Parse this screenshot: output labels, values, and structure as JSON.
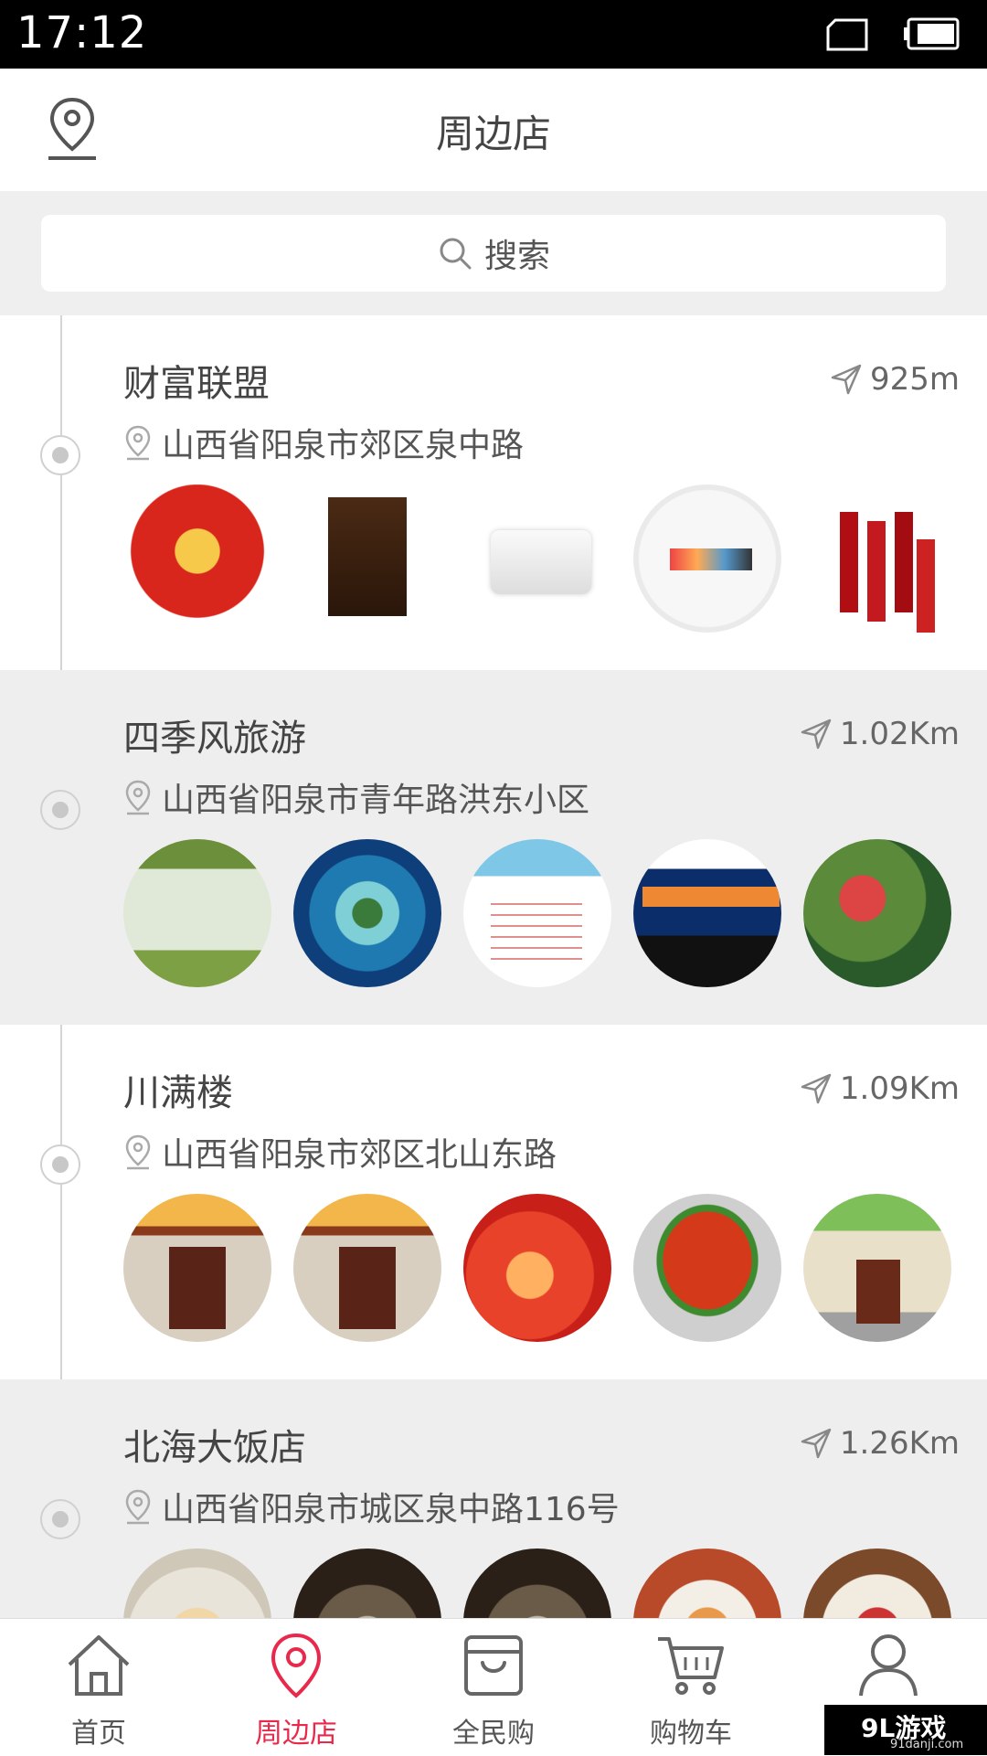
{
  "status_bar": {
    "time": "17:12"
  },
  "header": {
    "title": "周边店"
  },
  "search": {
    "placeholder": "搜索"
  },
  "stores": [
    {
      "name": "财富联盟",
      "distance": "925m",
      "address": "山西省阳泉市郊区泉中路"
    },
    {
      "name": "四季风旅游",
      "distance": "1.02Km",
      "address": "山西省阳泉市青年路洪东小区"
    },
    {
      "name": "川满楼",
      "distance": "1.09Km",
      "address": "山西省阳泉市郊区北山东路"
    },
    {
      "name": "北海大饭店",
      "distance": "1.26Km",
      "address": "山西省阳泉市城区泉中路116号"
    }
  ],
  "tabbar": {
    "items": [
      {
        "label": "首页",
        "icon": "home-icon"
      },
      {
        "label": "周边店",
        "icon": "location-pin-icon",
        "active": true
      },
      {
        "label": "全民购",
        "icon": "bag-icon"
      },
      {
        "label": "购物车",
        "icon": "cart-icon"
      },
      {
        "label": "",
        "icon": "user-icon"
      }
    ]
  },
  "watermark": {
    "line1": "9L游戏",
    "line2": "91danji.com"
  },
  "colors": {
    "accent": "#e8294b",
    "band": "#efefef",
    "timeline": "#d4d4d4"
  }
}
